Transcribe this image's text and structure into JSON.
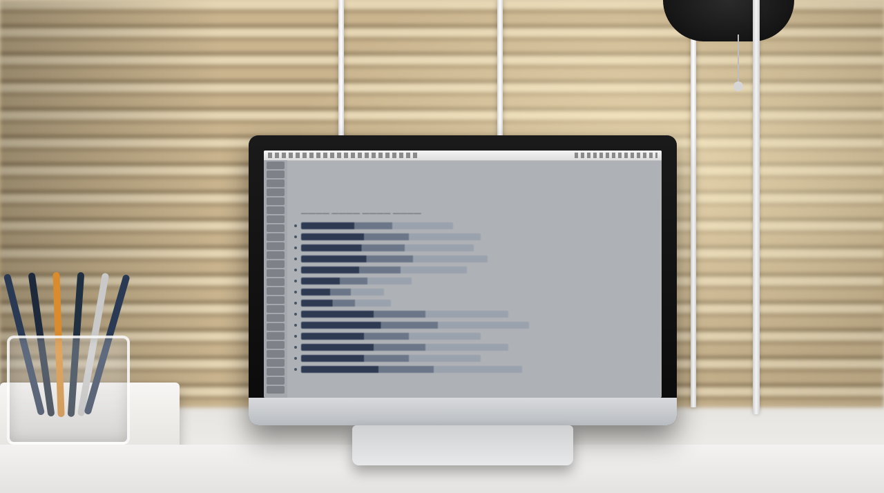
{
  "scene": {
    "description": "Photograph/render of a desk with an all-in-one monitor showing a text-editor window; text on the screen is blurred and not legibly resolvable.",
    "monitor_screen": {
      "note": "On-screen text is illegible in the source image; lines below are decorative placeholders sized to match the visual, not real content.",
      "heading_placeholder": "———— ———— ———— ————",
      "line_count": 14
    }
  }
}
